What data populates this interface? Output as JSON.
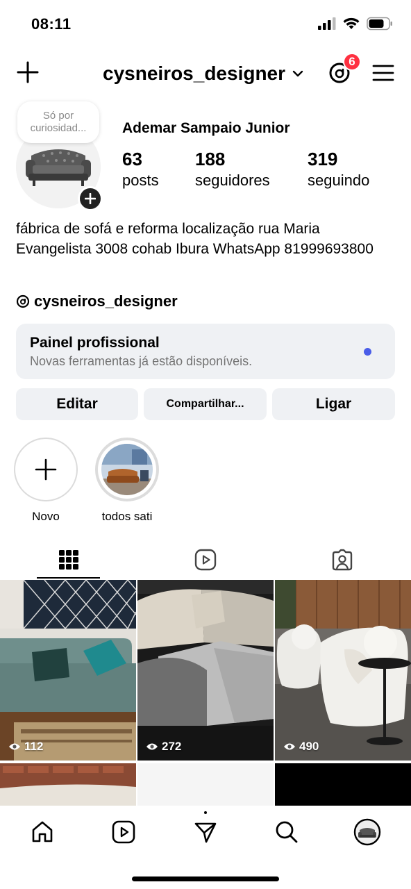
{
  "status_bar": {
    "time": "08:11"
  },
  "header": {
    "username": "cysneiros_designer",
    "threads_badge": "6"
  },
  "profile": {
    "note": "Só por curiosidad...",
    "full_name": "Ademar Sampaio Junior",
    "stats": [
      {
        "value": "63",
        "label": "posts"
      },
      {
        "value": "188",
        "label": "seguidores"
      },
      {
        "value": "319",
        "label": "seguindo"
      }
    ],
    "bio": "fábrica de sofá e reforma localização rua Maria Evangelista 3008 cohab Ibura WhatsApp 81999693800",
    "threads_handle": "cysneiros_designer"
  },
  "pro_panel": {
    "title": "Painel profissional",
    "subtitle": "Novas ferramentas já estão disponíveis."
  },
  "buttons": {
    "edit": "Editar",
    "share": "Compartilhar...",
    "call": "Ligar"
  },
  "highlights": [
    {
      "label": "Novo"
    },
    {
      "label": "todos sati"
    }
  ],
  "grid": [
    {
      "views": "112"
    },
    {
      "views": "272"
    },
    {
      "views": "490"
    }
  ]
}
